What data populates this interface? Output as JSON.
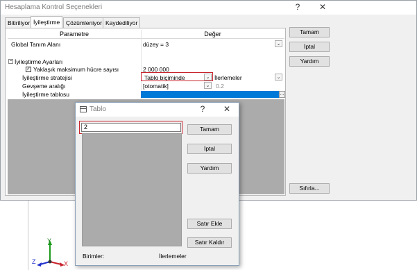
{
  "window": {
    "title": "Hesaplama Kontrol Seçenekleri",
    "help_glyph": "?",
    "close_glyph": "✕"
  },
  "tabs": [
    "Bitiriliyor",
    "İyileştirme",
    "Çözümleniyor",
    "Kaydediliyor"
  ],
  "grid": {
    "col_param": "Parametre",
    "col_value": "Değer",
    "rows": {
      "global_name": "Global Tanım Alanı",
      "global_value": "düzey = 3",
      "group_name": "İyileştirme Ayarları",
      "max_cells_name": "Yaklaşık maksimum hücre sayısı",
      "max_cells_value": "2 000 000",
      "strategy_name": "İyileştirme stratejisi",
      "strategy_value": "Tablo biçiminde",
      "strategy_value2": "İlerlemeler",
      "relax_name": "Gevşeme aralığı",
      "relax_value": "[otomatik]",
      "relax_value2": "0.2",
      "table_name": "İyileştirme tablosu",
      "table_ellipsis": "..."
    }
  },
  "side_buttons": {
    "ok": "Tamam",
    "cancel": "İptal",
    "help": "Yardım",
    "reset": "Sıfırla..."
  },
  "dialog": {
    "title": "Tablo",
    "help_glyph": "?",
    "close_glyph": "✕",
    "input_value": "2",
    "buttons": {
      "ok": "Tamam",
      "cancel": "İptal",
      "help": "Yardım",
      "add_row": "Satır Ekle",
      "remove_row": "Satır Kaldır"
    },
    "units_label": "Birimler:",
    "units_value": "İlerlemeler"
  },
  "triad": {
    "y": "Y",
    "z": "Z",
    "x": "X"
  },
  "colors": {
    "accent": "#0078d7",
    "highlight_box": "#c8232c"
  }
}
